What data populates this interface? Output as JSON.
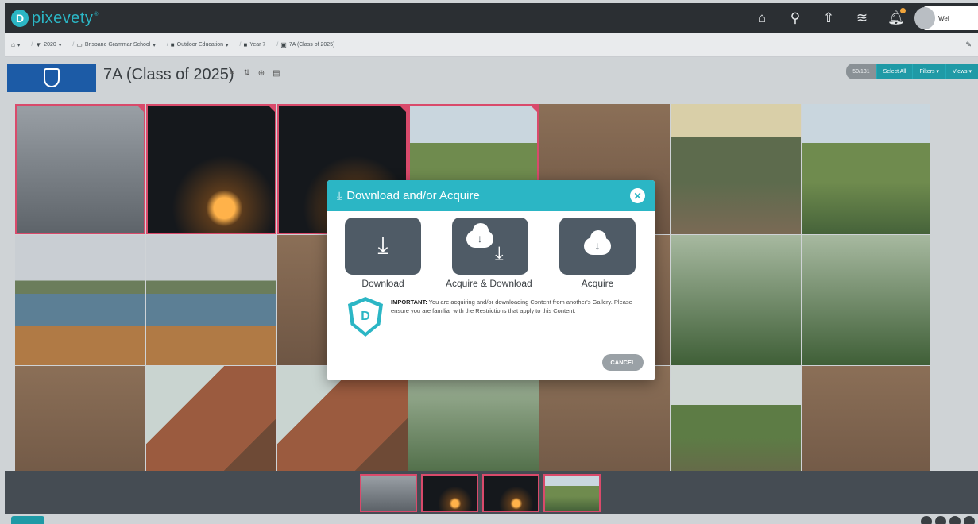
{
  "app": {
    "logo_letter": "D",
    "brand": "pixevety",
    "tm": "®"
  },
  "topbar": {
    "icons": [
      "home-icon",
      "search-icon",
      "upload-icon",
      "layers-icon",
      "bell-icon"
    ],
    "user_name": "Wel"
  },
  "breadcrumb": [
    {
      "icon": "home-icon",
      "label": ""
    },
    {
      "icon": "filter-icon",
      "label": "2020"
    },
    {
      "icon": "school-icon",
      "label": "Brisbane Grammar School"
    },
    {
      "icon": "folder-icon",
      "label": "Outdoor Education"
    },
    {
      "icon": "folder-icon",
      "label": "Year 7"
    },
    {
      "icon": "gallery-icon",
      "label": "7A (Class of 2025)"
    }
  ],
  "gallery": {
    "title": "7A (Class of 2025)"
  },
  "toolbar": {
    "count": "50/131",
    "select_all": "Select All",
    "filters": "Filters ▾",
    "views": "Views ▾"
  },
  "modal": {
    "title": "Download and/or Acquire",
    "options": [
      {
        "label": "Download",
        "icon": "download-icon"
      },
      {
        "label": "Acquire & Download",
        "icon": "cloud-download-icon"
      },
      {
        "label": "Acquire",
        "icon": "cloud-upload-icon"
      }
    ],
    "important_label": "IMPORTANT:",
    "important_text": "You are acquiring and/or downloading Content from another's Gallery. Please ensure you are familiar with the Restrictions that apply to this Content.",
    "cancel_label": "CANCEL"
  },
  "colors": {
    "accent": "#2bb6c5",
    "topbar": "#2b2f33",
    "selected_border": "#d94a6b",
    "option_tile": "#4f5b66"
  }
}
